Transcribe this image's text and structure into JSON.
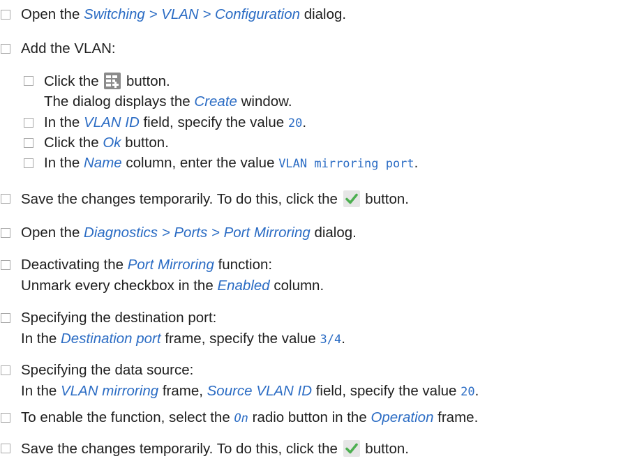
{
  "steps": [
    {
      "pre": "Open the ",
      "ref": "Switching > VLAN > Configuration",
      "post": " dialog."
    },
    {
      "text": "Add the VLAN:"
    },
    {
      "pre": "Click the ",
      "icon": "add-table-row-icon",
      "post": " button.",
      "line2_pre": "The dialog displays the ",
      "line2_ref": "Create",
      "line2_post": " window."
    },
    {
      "pre": "In the ",
      "ref": "VLAN ID",
      "mid": " field, specify the value ",
      "value": "20",
      "post": "."
    },
    {
      "pre": "Click the ",
      "ref": "Ok",
      "post": " button."
    },
    {
      "pre": "In the ",
      "ref": "Name",
      "mid": " column, enter the value ",
      "value": "VLAN mirroring port",
      "post": "."
    },
    {
      "pre": "Save the changes temporarily. To do this, click the ",
      "icon": "checkmark-icon",
      "post": " button."
    },
    {
      "pre": "Open the ",
      "ref": "Diagnostics > Ports > Port Mirroring",
      "post": " dialog."
    },
    {
      "pre": "Deactivating the ",
      "ref": "Port Mirroring",
      "post": " function:",
      "line2_pre": "Unmark every checkbox in the ",
      "line2_ref": "Enabled",
      "line2_post": " column."
    },
    {
      "text": "Specifying the destination port:",
      "line2_pre": "In the ",
      "line2_ref": "Destination port",
      "line2_mid": " frame, specify the value ",
      "line2_value": "3/4",
      "line2_post": "."
    },
    {
      "text": "Specifying the data source:",
      "line2_pre": "In the ",
      "line2_ref": "VLAN mirroring",
      "line2_mid": " frame, ",
      "line2_ref2": "Source VLAN ID",
      "line2_mid2": " field, specify the value ",
      "line2_value": "20",
      "line2_post": "."
    },
    {
      "pre": "To enable the function, select the ",
      "value": "On",
      "mid": " radio button in the ",
      "ref": "Operation",
      "post": " frame."
    },
    {
      "pre": "Save the changes temporarily. To do this, click the ",
      "icon": "checkmark-icon",
      "post": " button."
    }
  ],
  "colors": {
    "text": "#1f1f1f",
    "reference": "#2b6cc4",
    "checkbox_border": "#a8a8a8",
    "checkmark_green": "#4caf50",
    "add_icon_gray": "#8a8a8a"
  }
}
